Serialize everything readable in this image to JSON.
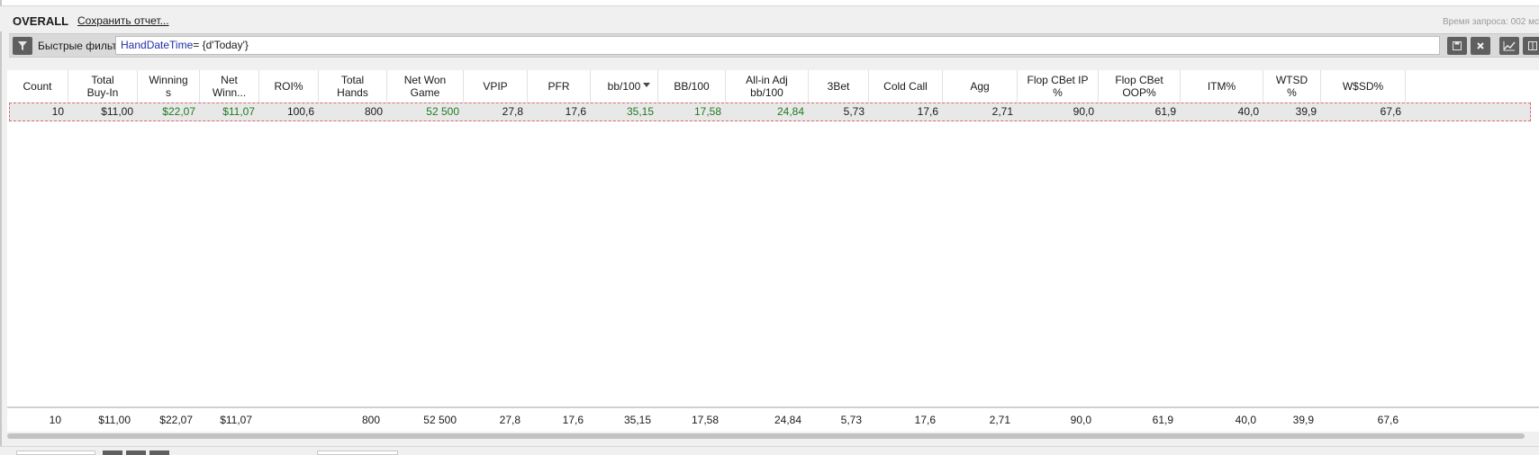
{
  "header": {
    "title": "OVERALL",
    "save_report": "Сохранить отчет...",
    "query_time": "Время запроса: 002 мс"
  },
  "filter": {
    "label": "Быстрые фильт",
    "expression_keyword": "HandDateTime",
    "expression_rest": "= {d'Today'}",
    "icons": [
      "filter-icon",
      "save-icon",
      "clear-icon",
      "chart-icon",
      "columns-icon"
    ]
  },
  "columns": [
    {
      "key": "count",
      "label": "Count"
    },
    {
      "key": "total_buyin",
      "label": "Total\nBuy-In"
    },
    {
      "key": "winnings",
      "label": "Winning\ns"
    },
    {
      "key": "net_winnings",
      "label": "Net\nWinn..."
    },
    {
      "key": "roi",
      "label": "ROI%"
    },
    {
      "key": "total_hands",
      "label": "Total\nHands"
    },
    {
      "key": "net_won_game",
      "label": "Net Won\nGame"
    },
    {
      "key": "vpip",
      "label": "VPIP"
    },
    {
      "key": "pfr",
      "label": "PFR"
    },
    {
      "key": "bb100",
      "label": "bb/100",
      "sorted": "desc"
    },
    {
      "key": "BB100",
      "label": "BB/100"
    },
    {
      "key": "allin_adj",
      "label": "All-in Adj\nbb/100"
    },
    {
      "key": "threebet",
      "label": "3Bet"
    },
    {
      "key": "cold_call",
      "label": "Cold Call"
    },
    {
      "key": "agg",
      "label": "Agg"
    },
    {
      "key": "flop_cbet_ip",
      "label": "Flop CBet IP\n%"
    },
    {
      "key": "flop_cbet_oop",
      "label": "Flop CBet\nOOP%"
    },
    {
      "key": "itm",
      "label": "ITM%"
    },
    {
      "key": "wtsd",
      "label": "WTSD\n%"
    },
    {
      "key": "wsd",
      "label": "W$SD%"
    }
  ],
  "rows": [
    [
      "10",
      "$11,00",
      "$22,07",
      "$11,07",
      "100,6",
      "800",
      "52 500",
      "27,8",
      "17,6",
      "35,15",
      "17,58",
      "24,84",
      "5,73",
      "17,6",
      "2,71",
      "90,0",
      "61,9",
      "40,0",
      "39,9",
      "67,6"
    ]
  ],
  "row_green": [
    2,
    3,
    6,
    9,
    10,
    11
  ],
  "totals": [
    "10",
    "$11,00",
    "$22,07",
    "$11,07",
    "",
    "800",
    "52 500",
    "27,8",
    "17,6",
    "35,15",
    "17,58",
    "24,84",
    "5,73",
    "17,6",
    "2,71",
    "90,0",
    "61,9",
    "40,0",
    "39,9",
    "67,6"
  ],
  "colors": {
    "positive": "#1f7a1f",
    "selected_row_border": "#d96a6a",
    "toolbar_button": "#5f5f5f",
    "filter_keyword": "#1f2fa8"
  }
}
